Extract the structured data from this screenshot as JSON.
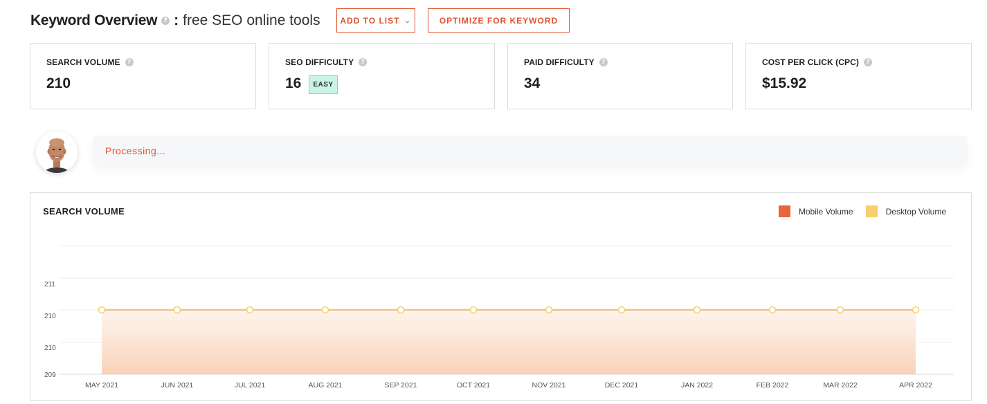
{
  "header": {
    "title": "Keyword Overview",
    "help_icon": "question-circle-icon",
    "separator": ":",
    "keyword": "free SEO online tools"
  },
  "buttons": {
    "add_to_list": "ADD TO LIST",
    "add_to_list_icon": "chevron-down-icon",
    "optimize": "OPTIMIZE FOR KEYWORD"
  },
  "metrics": [
    {
      "label": "SEARCH VOLUME",
      "value": "210"
    },
    {
      "label": "SEO DIFFICULTY",
      "value": "16",
      "badge": "EASY"
    },
    {
      "label": "PAID DIFFICULTY",
      "value": "34"
    },
    {
      "label": "COST PER CLICK (CPC)",
      "value": "$15.92"
    }
  ],
  "status": {
    "message": "Processing..."
  },
  "colors": {
    "accent": "#e0532f",
    "mobile": "#e8643a",
    "desktop": "#f7cf6c",
    "easy_badge_bg": "#c9f5e4",
    "easy_badge_border": "#7ddbb8"
  },
  "chart_data": {
    "type": "area",
    "title": "SEARCH VOLUME",
    "legend": [
      "Mobile Volume",
      "Desktop Volume"
    ],
    "legend_position": "top-right",
    "x": [
      "MAY 2021",
      "JUN 2021",
      "JUL 2021",
      "AUG 2021",
      "SEP 2021",
      "OCT 2021",
      "NOV 2021",
      "DEC 2021",
      "JAN 2022",
      "FEB 2022",
      "MAR 2022",
      "APR 2022"
    ],
    "y_ticks": [
      "209",
      "210",
      "210",
      "211"
    ],
    "series": [
      {
        "name": "Desktop Volume",
        "values": [
          210,
          210,
          210,
          210,
          210,
          210,
          210,
          210,
          210,
          210,
          210,
          210
        ]
      }
    ],
    "ylim": [
      209,
      211
    ],
    "grid": true
  }
}
